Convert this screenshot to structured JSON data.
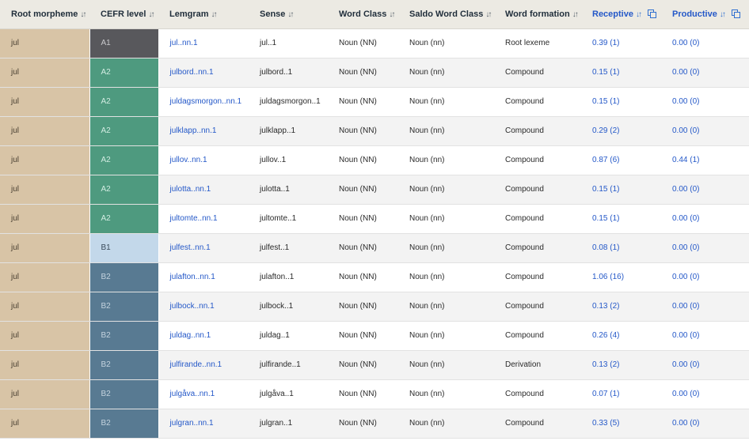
{
  "table": {
    "headers": [
      {
        "label": "Root morpheme",
        "icon": "sort-icon"
      },
      {
        "label": "CEFR level",
        "icon": "sort-icon"
      },
      {
        "label": "Lemgram",
        "icon": "sort-icon"
      },
      {
        "label": "Sense",
        "icon": "sort-icon"
      },
      {
        "label": "Word Class",
        "icon": "sort-icon"
      },
      {
        "label": "Saldo Word Class",
        "icon": "sort-icon"
      },
      {
        "label": "Word formation",
        "icon": "sort-icon"
      },
      {
        "label": "Receptive",
        "icon": "sort-icon",
        "extra_icon": "copy-icon"
      },
      {
        "label": "Productive",
        "icon": "sort-icon",
        "extra_icon": "copy-icon"
      }
    ],
    "cefr_colors": {
      "A1": {
        "bg": "#58585c",
        "fg": "#c9c9cc"
      },
      "A2": {
        "bg": "#4e9a7f",
        "fg": "#d2ece2"
      },
      "B1": {
        "bg": "#c3d8ea",
        "fg": "#3a4a5a"
      },
      "B2": {
        "bg": "#587a92",
        "fg": "#c4d3de"
      }
    },
    "root_color": "#d8c4a6",
    "link_color": "#2458c8",
    "rows": [
      {
        "root": "jul",
        "cefr": "A1",
        "lemgram": "jul..nn.1",
        "sense": "jul..1",
        "word_class": "Noun (NN)",
        "saldo_class": "Noun (nn)",
        "formation": "Root lexeme",
        "receptive": "0.39 (1)",
        "productive": "0.00 (0)"
      },
      {
        "root": "jul",
        "cefr": "A2",
        "lemgram": "julbord..nn.1",
        "sense": "julbord..1",
        "word_class": "Noun (NN)",
        "saldo_class": "Noun (nn)",
        "formation": "Compound",
        "receptive": "0.15 (1)",
        "productive": "0.00 (0)"
      },
      {
        "root": "jul",
        "cefr": "A2",
        "lemgram": "juldagsmorgon..nn.1",
        "sense": "juldagsmorgon..1",
        "word_class": "Noun (NN)",
        "saldo_class": "Noun (nn)",
        "formation": "Compound",
        "receptive": "0.15 (1)",
        "productive": "0.00 (0)"
      },
      {
        "root": "jul",
        "cefr": "A2",
        "lemgram": "julklapp..nn.1",
        "sense": "julklapp..1",
        "word_class": "Noun (NN)",
        "saldo_class": "Noun (nn)",
        "formation": "Compound",
        "receptive": "0.29 (2)",
        "productive": "0.00 (0)"
      },
      {
        "root": "jul",
        "cefr": "A2",
        "lemgram": "jullov..nn.1",
        "sense": "jullov..1",
        "word_class": "Noun (NN)",
        "saldo_class": "Noun (nn)",
        "formation": "Compound",
        "receptive": "0.87 (6)",
        "productive": "0.44 (1)"
      },
      {
        "root": "jul",
        "cefr": "A2",
        "lemgram": "julotta..nn.1",
        "sense": "julotta..1",
        "word_class": "Noun (NN)",
        "saldo_class": "Noun (nn)",
        "formation": "Compound",
        "receptive": "0.15 (1)",
        "productive": "0.00 (0)"
      },
      {
        "root": "jul",
        "cefr": "A2",
        "lemgram": "jultomte..nn.1",
        "sense": "jultomte..1",
        "word_class": "Noun (NN)",
        "saldo_class": "Noun (nn)",
        "formation": "Compound",
        "receptive": "0.15 (1)",
        "productive": "0.00 (0)"
      },
      {
        "root": "jul",
        "cefr": "B1",
        "lemgram": "julfest..nn.1",
        "sense": "julfest..1",
        "word_class": "Noun (NN)",
        "saldo_class": "Noun (nn)",
        "formation": "Compound",
        "receptive": "0.08 (1)",
        "productive": "0.00 (0)"
      },
      {
        "root": "jul",
        "cefr": "B2",
        "lemgram": "julafton..nn.1",
        "sense": "julafton..1",
        "word_class": "Noun (NN)",
        "saldo_class": "Noun (nn)",
        "formation": "Compound",
        "receptive": "1.06 (16)",
        "productive": "0.00 (0)"
      },
      {
        "root": "jul",
        "cefr": "B2",
        "lemgram": "julbock..nn.1",
        "sense": "julbock..1",
        "word_class": "Noun (NN)",
        "saldo_class": "Noun (nn)",
        "formation": "Compound",
        "receptive": "0.13 (2)",
        "productive": "0.00 (0)"
      },
      {
        "root": "jul",
        "cefr": "B2",
        "lemgram": "juldag..nn.1",
        "sense": "juldag..1",
        "word_class": "Noun (NN)",
        "saldo_class": "Noun (nn)",
        "formation": "Compound",
        "receptive": "0.26 (4)",
        "productive": "0.00 (0)"
      },
      {
        "root": "jul",
        "cefr": "B2",
        "lemgram": "julfirande..nn.1",
        "sense": "julfirande..1",
        "word_class": "Noun (NN)",
        "saldo_class": "Noun (nn)",
        "formation": "Derivation",
        "receptive": "0.13 (2)",
        "productive": "0.00 (0)"
      },
      {
        "root": "jul",
        "cefr": "B2",
        "lemgram": "julgåva..nn.1",
        "sense": "julgåva..1",
        "word_class": "Noun (NN)",
        "saldo_class": "Noun (nn)",
        "formation": "Compound",
        "receptive": "0.07 (1)",
        "productive": "0.00 (0)"
      },
      {
        "root": "jul",
        "cefr": "B2",
        "lemgram": "julgran..nn.1",
        "sense": "julgran..1",
        "word_class": "Noun (NN)",
        "saldo_class": "Noun (nn)",
        "formation": "Compound",
        "receptive": "0.33 (5)",
        "productive": "0.00 (0)"
      }
    ]
  }
}
